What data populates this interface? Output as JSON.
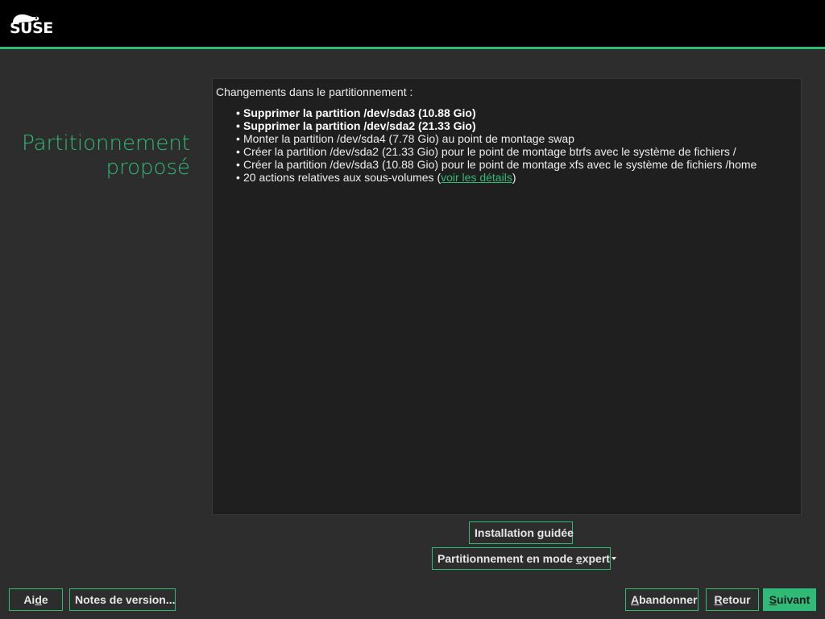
{
  "header": {
    "logo_text": "SUSE",
    "accent_color": "#30ba78"
  },
  "page": {
    "title_line1": "Partitionnement",
    "title_line2": "proposé"
  },
  "summary": {
    "heading": "Changements dans le partitionnement :",
    "items": [
      {
        "text": "Supprimer la partition /dev/sda3 (10.88 Gio)",
        "bold": true
      },
      {
        "text": "Supprimer la partition /dev/sda2 (21.33 Gio)",
        "bold": true
      },
      {
        "text": "Monter la partition /dev/sda4 (7.78 Gio) au point de montage swap",
        "bold": false
      },
      {
        "text": "Créer la partition /dev/sda2 (21.33 Gio) pour le point de montage btrfs avec le système de fichiers /",
        "bold": false
      },
      {
        "text": "Créer la partition /dev/sda3 (10.88 Gio) pour le point de montage xfs avec le système de fichiers /home",
        "bold": false
      }
    ],
    "subvolumes_prefix": "20 actions relatives aux sous-volumes (",
    "subvolumes_link": "voir les détails",
    "subvolumes_suffix": ")",
    "bullet": "•"
  },
  "actions": {
    "guided_pre": "Installation ",
    "guided_accel": "g",
    "guided_post": "uidée",
    "expert_pre": "Partitionnement en mode ",
    "expert_accel": "e",
    "expert_post": "xpert"
  },
  "footer": {
    "help_pre": "Ai",
    "help_accel": "d",
    "help_post": "e",
    "release_notes_label": "Notes de version...",
    "abort_accel": "A",
    "abort_post": "bandonner",
    "back_accel": "R",
    "back_post": "etour",
    "next_accel": "S",
    "next_post": "uivant"
  }
}
